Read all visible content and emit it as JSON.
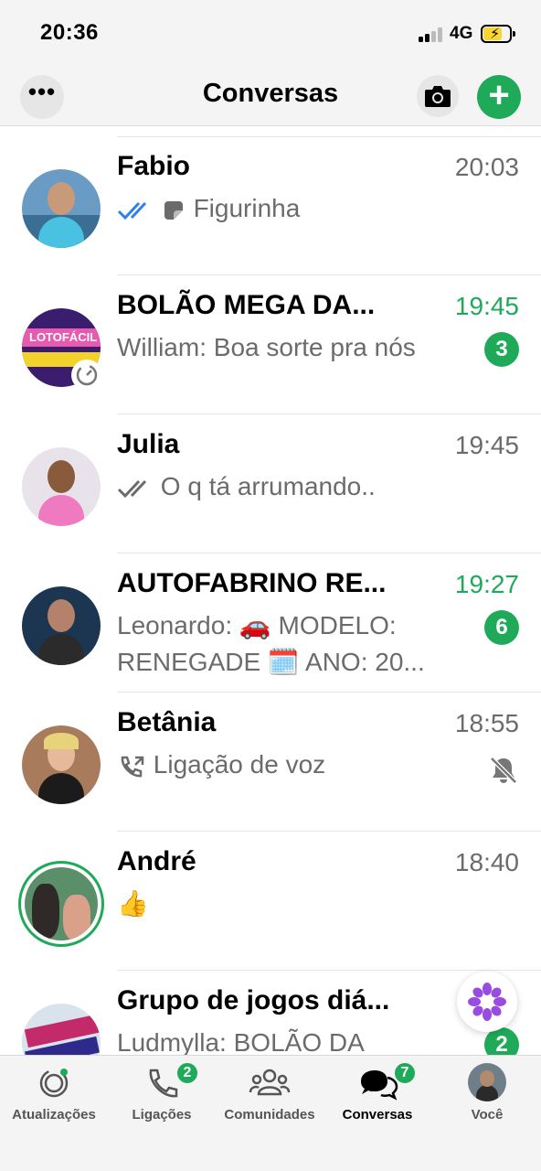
{
  "status_bar": {
    "time": "20:36",
    "network": "4G"
  },
  "header": {
    "title": "Conversas",
    "more_label": "•••"
  },
  "chats": [
    {
      "name": "Fabio",
      "time": "20:03",
      "preview": "Figurinha",
      "unread": false,
      "status": "read"
    },
    {
      "name": "BOLÃO MEGA DA...",
      "time": "19:45",
      "preview": "William: Boa sorte pra nós",
      "unread": true,
      "badge": "3"
    },
    {
      "name": "Julia",
      "time": "19:45",
      "preview": "O q tá arrumando..",
      "unread": false,
      "status": "delivered"
    },
    {
      "name": "AUTOFABRINO RE...",
      "time": "19:27",
      "preview_line1": "Leonardo: 🚗 MODELO:",
      "preview_line2": "RENEGADE 🗓️ ANO: 20...",
      "unread": true,
      "badge": "6"
    },
    {
      "name": "Betânia",
      "time": "18:55",
      "preview": "Ligação de voz",
      "unread": false,
      "muted": true
    },
    {
      "name": "André",
      "time": "18:40",
      "preview": "👍",
      "unread": false
    },
    {
      "name": "Grupo de jogos diá...",
      "time": "",
      "preview": "Ludmylla: BOLÃO DA",
      "unread": true,
      "badge": "2"
    }
  ],
  "tabs": [
    {
      "label": "Atualizações",
      "icon": "updates-icon"
    },
    {
      "label": "Ligações",
      "icon": "phone-icon",
      "badge": "2"
    },
    {
      "label": "Comunidades",
      "icon": "communities-icon"
    },
    {
      "label": "Conversas",
      "icon": "chats-icon",
      "badge": "7",
      "active": true
    },
    {
      "label": "Você",
      "icon": "avatar-icon"
    }
  ],
  "colors": {
    "accent": "#1faa5a",
    "read_ticks": "#2f80ed",
    "muted_text": "#6b6b6b"
  }
}
